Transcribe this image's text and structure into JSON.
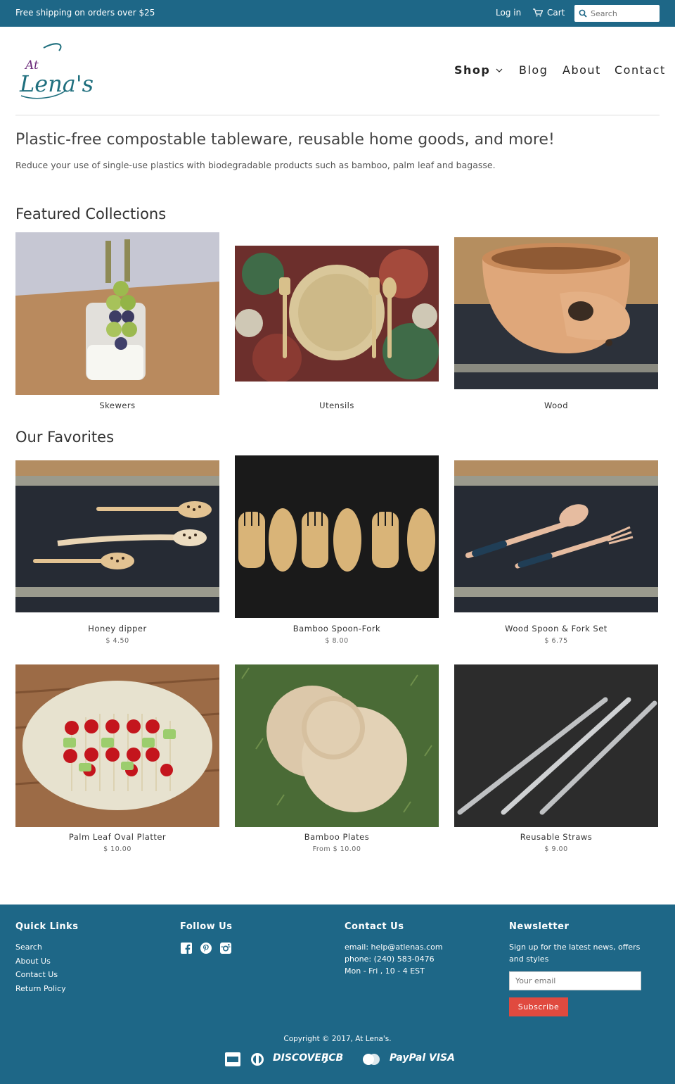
{
  "topbar": {
    "promo": "Free shipping on orders over $25",
    "login": "Log in",
    "cart": "Cart",
    "search_placeholder": "Search"
  },
  "brand": {
    "logo_text_small": "At",
    "logo_text_large": "Lena's"
  },
  "nav": {
    "shop": "Shop",
    "blog": "Blog",
    "about": "About",
    "contact": "Contact"
  },
  "intro": {
    "title": "Plastic-free compostable tableware, reusable home goods, and more!",
    "subtitle": "Reduce your use of single-use plastics with biodegradable products such as bamboo, palm leaf and bagasse."
  },
  "featured": {
    "title": "Featured Collections",
    "items": [
      {
        "label": "Skewers"
      },
      {
        "label": "Utensils"
      },
      {
        "label": "Wood"
      }
    ]
  },
  "favorites": {
    "title": "Our Favorites",
    "items": [
      {
        "label": "Honey dipper",
        "price": "$ 4.50"
      },
      {
        "label": "Bamboo Spoon-Fork",
        "price": "$ 8.00"
      },
      {
        "label": "Wood Spoon & Fork Set",
        "price": "$ 6.75"
      },
      {
        "label": "Palm Leaf Oval Platter",
        "price": "$ 10.00"
      },
      {
        "label": "Bamboo Plates",
        "price": "From $ 10.00"
      },
      {
        "label": "Reusable Straws",
        "price": "$ 9.00"
      }
    ]
  },
  "footer": {
    "quick_links": {
      "title": "Quick Links",
      "items": [
        "Search",
        "About Us",
        "Contact Us",
        "Return Policy"
      ]
    },
    "follow": {
      "title": "Follow Us",
      "icons": [
        "facebook-icon",
        "pinterest-icon",
        "instagram-icon"
      ]
    },
    "contact": {
      "title": "Contact Us",
      "email": "email: help@atlenas.com",
      "phone": "phone: (240) 583-0476",
      "hours": "Mon - Fri , 10 - 4 EST"
    },
    "newsletter": {
      "title": "Newsletter",
      "text": "Sign up for the latest news, offers and styles",
      "placeholder": "Your email",
      "button": "Subscribe"
    },
    "copyright": "Copyright © 2017, At Lena's.",
    "payments": {
      "discover": "DISCOVER",
      "jcb": "JCB",
      "paypal": "PayPal",
      "visa": "VISA"
    }
  },
  "colors": {
    "primary": "#1e6787",
    "accent": "#e04a3f",
    "logo_teal": "#1f6f7e",
    "logo_purple": "#6b2a7a"
  }
}
